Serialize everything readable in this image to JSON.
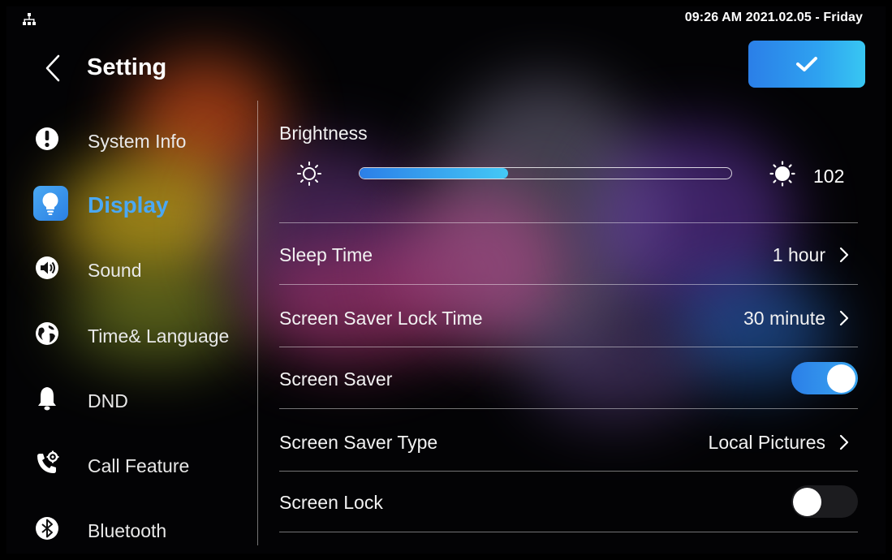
{
  "status_bar": {
    "datetime": "09:26 AM  2021.02.05 - Friday",
    "network_icon": "network-icon"
  },
  "header": {
    "title": "Setting",
    "back_icon": "chevron-left-icon",
    "confirm_icon": "checkmark-icon"
  },
  "colors": {
    "accent": "#2b7fe8",
    "accent_light": "#44c8f5",
    "active_text": "#4aa8f4",
    "background": "#030305"
  },
  "sidebar": {
    "items": [
      {
        "label": "System Info",
        "icon": "info-icon",
        "active": false
      },
      {
        "label": "Display",
        "icon": "lightbulb-icon",
        "active": true
      },
      {
        "label": "Sound",
        "icon": "speaker-icon",
        "active": false
      },
      {
        "label": "Time& Language",
        "icon": "globe-icon",
        "active": false
      },
      {
        "label": "DND",
        "icon": "bell-icon",
        "active": false
      },
      {
        "label": "Call Feature",
        "icon": "phone-gear-icon",
        "active": false
      },
      {
        "label": "Bluetooth",
        "icon": "bluetooth-icon",
        "active": false
      }
    ]
  },
  "display": {
    "brightness": {
      "label": "Brightness",
      "value": "102",
      "fill_fraction": 0.4
    },
    "sleep_time": {
      "label": "Sleep Time",
      "value": "1 hour"
    },
    "screen_saver_lock_time": {
      "label": "Screen Saver Lock Time",
      "value": "30 minute"
    },
    "screen_saver": {
      "label": "Screen Saver",
      "enabled": true
    },
    "screen_saver_type": {
      "label": "Screen Saver Type",
      "value": "Local Pictures"
    },
    "screen_lock": {
      "label": "Screen Lock",
      "enabled": false
    }
  }
}
